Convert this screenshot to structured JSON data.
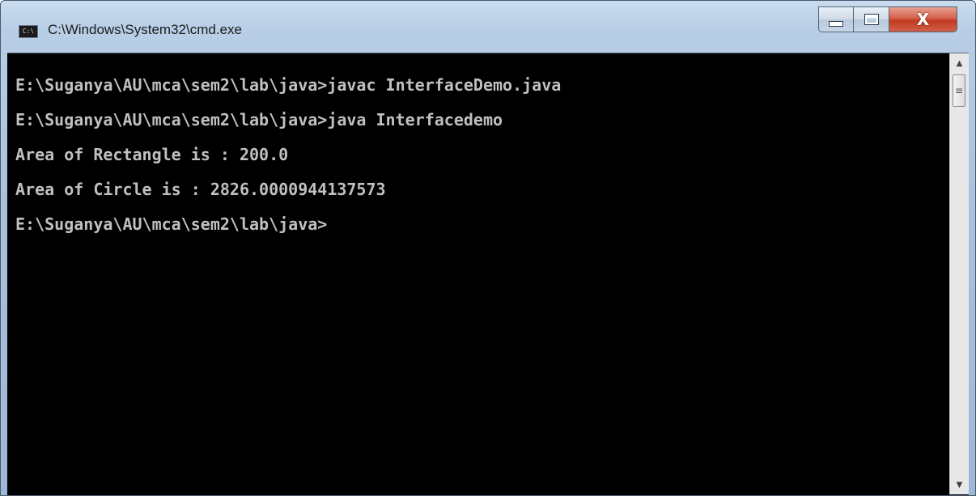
{
  "window": {
    "title": "C:\\Windows\\System32\\cmd.exe",
    "icon": "cmd-icon",
    "icon_text": "C:\\",
    "controls": {
      "minimize_icon": "minimize-icon",
      "maximize_icon": "maximize-icon",
      "close_icon": "close-icon",
      "close_label": "X"
    }
  },
  "console": {
    "lines": [
      "E:\\Suganya\\AU\\mca\\sem2\\lab\\java>javac InterfaceDemo.java",
      "E:\\Suganya\\AU\\mca\\sem2\\lab\\java>java Interfacedemo",
      "Area of Rectangle is : 200.0",
      "Area of Circle is : 2826.0000944137573",
      "E:\\Suganya\\AU\\mca\\sem2\\lab\\java>"
    ],
    "text_color": "#c0c0c0",
    "background_color": "#000000"
  },
  "scrollbar": {
    "up_arrow_icon": "scroll-up-icon",
    "down_arrow_icon": "scroll-down-icon",
    "up_glyph": "▲",
    "down_glyph": "▼",
    "grip_glyph": "≡"
  }
}
